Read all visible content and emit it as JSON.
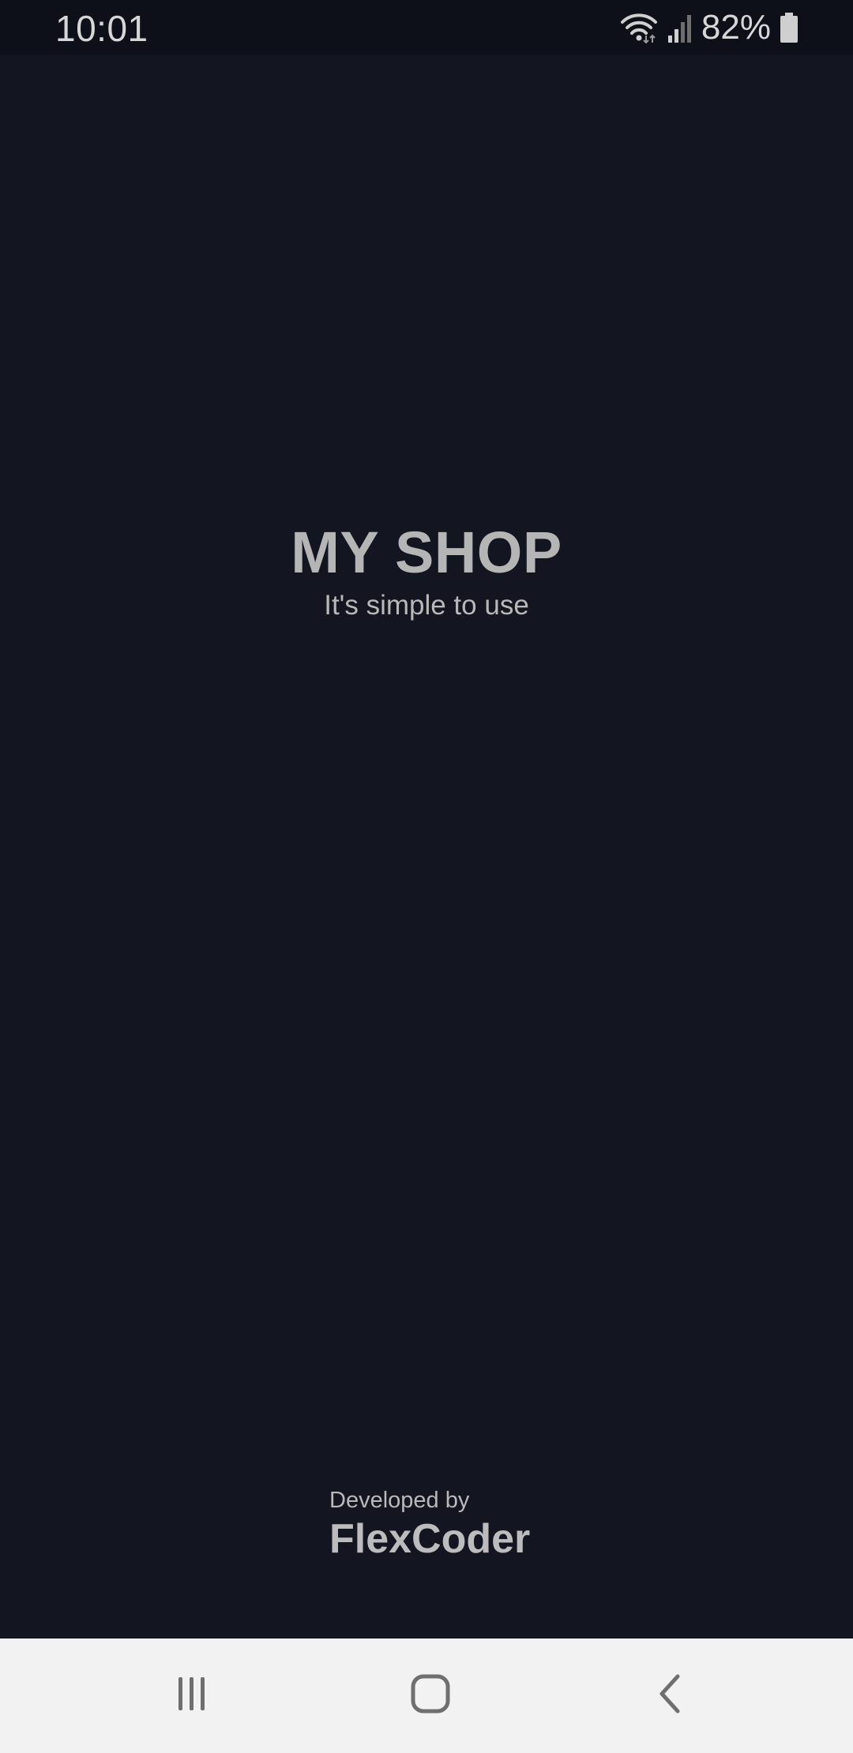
{
  "status_bar": {
    "time": "10:01",
    "battery_percent": "82%",
    "icons": [
      "wifi-icon",
      "signal-icon",
      "battery-icon"
    ]
  },
  "splash": {
    "title": "MY SHOP",
    "tagline": "It's simple to use"
  },
  "footer": {
    "developed_by_label": "Developed by",
    "developer_name": "FlexCoder"
  },
  "nav_bar": {
    "buttons": [
      "recent-apps-icon",
      "home-icon",
      "back-icon"
    ]
  },
  "colors": {
    "background": "#131520",
    "status_bar": "#0e1019",
    "text": "#b5b5b5",
    "nav_bar": "#f2f2f2",
    "nav_icon": "#6f6f6f"
  }
}
